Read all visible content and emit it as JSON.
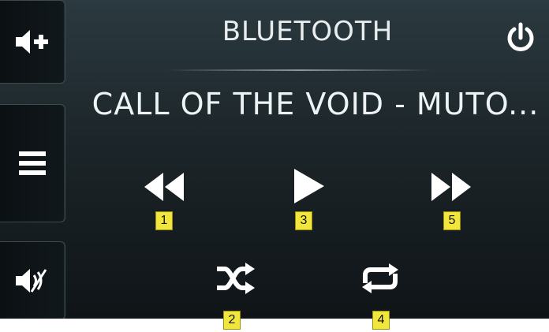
{
  "header": {
    "title": "BLUETOOTH"
  },
  "now_playing": {
    "track": "CALL OF THE VOID - MUTO..."
  },
  "sidebar": {
    "items": [
      {
        "name": "volume-up-button",
        "icon": "volume-up-icon"
      },
      {
        "name": "menu-button",
        "icon": "menu-icon"
      },
      {
        "name": "mute-button",
        "icon": "mute-icon"
      }
    ]
  },
  "controls": {
    "rewind_icon": "rewind-icon",
    "play_icon": "play-icon",
    "fast_forward_icon": "fast-forward-icon",
    "shuffle_icon": "shuffle-icon",
    "repeat_icon": "repeat-icon",
    "power_icon": "power-icon"
  },
  "callouts": {
    "rewind": "1",
    "shuffle": "2",
    "play": "3",
    "repeat": "4",
    "fast_forward": "5"
  },
  "colors": {
    "icon": "#ffffff",
    "badge": "#f1e63c",
    "background_top": "#2b3a40",
    "background_bottom": "#0f1417"
  }
}
